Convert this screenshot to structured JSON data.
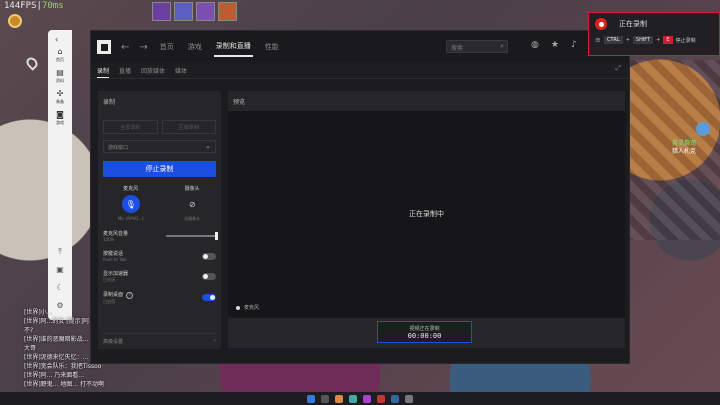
{
  "game": {
    "fps": "144FPS",
    "ping": "70ms",
    "npc_name": "英灵祭司",
    "npc_sub": "猎人札克"
  },
  "side_nav": {
    "items": [
      {
        "icon": "home-icon",
        "label": "首页"
      },
      {
        "icon": "archive-icon",
        "label": "资料"
      },
      {
        "icon": "wind-icon",
        "label": "装备"
      },
      {
        "icon": "controller-icon",
        "label": "游戏"
      }
    ]
  },
  "chat": {
    "lines": [
      "[世界]小...",
      "[世界]阿...的女 [提示]阿...",
      "不?",
      "[世界]谁的恶魔暗影战...",
      "大哥",
      "[世界]泥德来忆失忆：...",
      "[世界]宽会队乐：我把Tissoo",
      "[世界]阿... 乃来面看...",
      "[世界]野鬼... 地图... 打不动啊"
    ]
  },
  "window": {
    "tabs": [
      "首页",
      "游戏",
      "录制和直播",
      "性能"
    ],
    "active_tab": 2,
    "search_placeholder": "搜索",
    "subtabs": [
      "录制",
      "直播",
      "回放媒体",
      "媒体"
    ],
    "active_subtab": 0
  },
  "record_panel": {
    "title": "录制",
    "btn_full": "全屏录制",
    "btn_region": "区域录制",
    "dropdown": "游戏窗口",
    "stop_label": "停止录制",
    "mic_label": "麦克风",
    "mic_device": "Mic (RAVO...)",
    "cam_label": "摄像头",
    "cam_device": "无摄像头",
    "volume_label": "麦克风音量",
    "volume_sub": "100%",
    "volume_level": 1.0,
    "noise_label": "按键说话",
    "noise_sub": "Push to Talk",
    "noise_on": false,
    "show_label": "显示加速器",
    "show_sub": "已关闭",
    "show_on": false,
    "rec_desktop_label": "录制桌面",
    "rec_desktop_sub": "已启用",
    "rec_desktop_on": true,
    "advanced_label": "高级设置"
  },
  "preview": {
    "title": "预览",
    "status": "正在录制中",
    "audio_label": "麦克风",
    "rec_label": "视频正在录制",
    "rec_time": "00:00:00"
  },
  "overlay": {
    "title": "正在录制",
    "keys": [
      "CTRL",
      "SHIFT",
      "E"
    ],
    "key_action": "停止录制",
    "accent": "#cc2030"
  },
  "colors": {
    "accent": "#1b4fe0",
    "panel": "#262628",
    "window": "#1c1c1e"
  }
}
